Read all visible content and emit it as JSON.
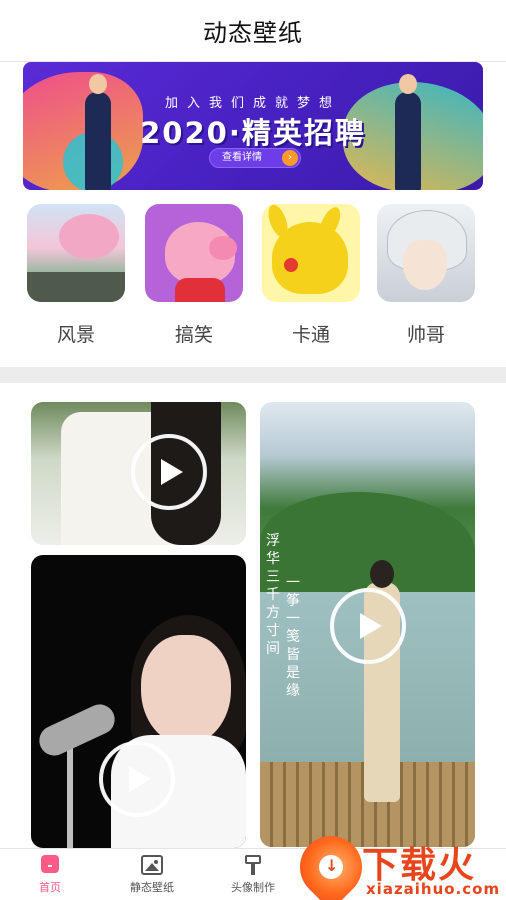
{
  "header": {
    "title": "动态壁纸"
  },
  "banner": {
    "subtitle": "加入我们成就梦想",
    "headline": "2020·精英招聘",
    "button_label": "查看详情",
    "button_arrow": "›"
  },
  "categories": [
    {
      "label": "风景",
      "icon": "scenery-thumbnail"
    },
    {
      "label": "搞笑",
      "icon": "peppa-pig-thumbnail"
    },
    {
      "label": "卡通",
      "icon": "pikachu-thumbnail"
    },
    {
      "label": "帅哥",
      "icon": "anime-boy-thumbnail"
    }
  ],
  "videos": [
    {
      "icon": "play-icon"
    },
    {
      "icon": "play-icon",
      "poem_line1": "浮华三千方寸间",
      "poem_line2": "一筝一笺皆是缘"
    },
    {
      "icon": "play-icon"
    }
  ],
  "nav": {
    "items": [
      {
        "label": "首页",
        "icon": "home-icon",
        "active": true
      },
      {
        "label": "静态壁纸",
        "icon": "picture-icon",
        "active": false
      },
      {
        "label": "头像制作",
        "icon": "brush-icon",
        "active": false
      }
    ]
  },
  "watermark": {
    "brand": "下载火",
    "domain": "xiazaihuo.com"
  },
  "colors": {
    "accent": "#ff5a8a",
    "watermark": "#e8451c",
    "banner": "#4a22c4"
  }
}
